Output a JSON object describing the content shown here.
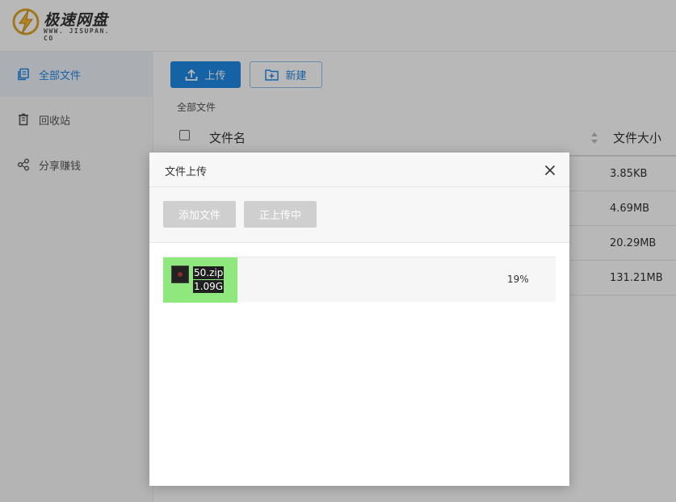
{
  "logo": {
    "title": "极速网盘",
    "subtitle": "WWW. JISUPAN. CO",
    "icon": "lightning-bolt-icon"
  },
  "sidebar": {
    "items": [
      {
        "label": "全部文件",
        "icon": "files-icon",
        "active": true
      },
      {
        "label": "回收站",
        "icon": "trash-icon",
        "active": false
      },
      {
        "label": "分享赚钱",
        "icon": "share-icon",
        "active": false
      }
    ]
  },
  "toolbar": {
    "upload_label": "上传",
    "new_label": "新建"
  },
  "breadcrumb": "全部文件",
  "table": {
    "headers": {
      "name": "文件名",
      "size": "文件大小"
    },
    "rows": [
      {
        "size": "3.85KB"
      },
      {
        "size": "4.69MB"
      },
      {
        "size": "20.29MB"
      },
      {
        "size": "131.21MB"
      }
    ]
  },
  "modal": {
    "title": "文件上传",
    "add_files_label": "添加文件",
    "uploading_label": "正上传中",
    "file": {
      "name": "50.zip",
      "size": "1.09G",
      "progress_percent": 19,
      "progress_label": "19%"
    }
  },
  "colors": {
    "accent": "#1e88e5",
    "progress": "#8ee87d"
  }
}
